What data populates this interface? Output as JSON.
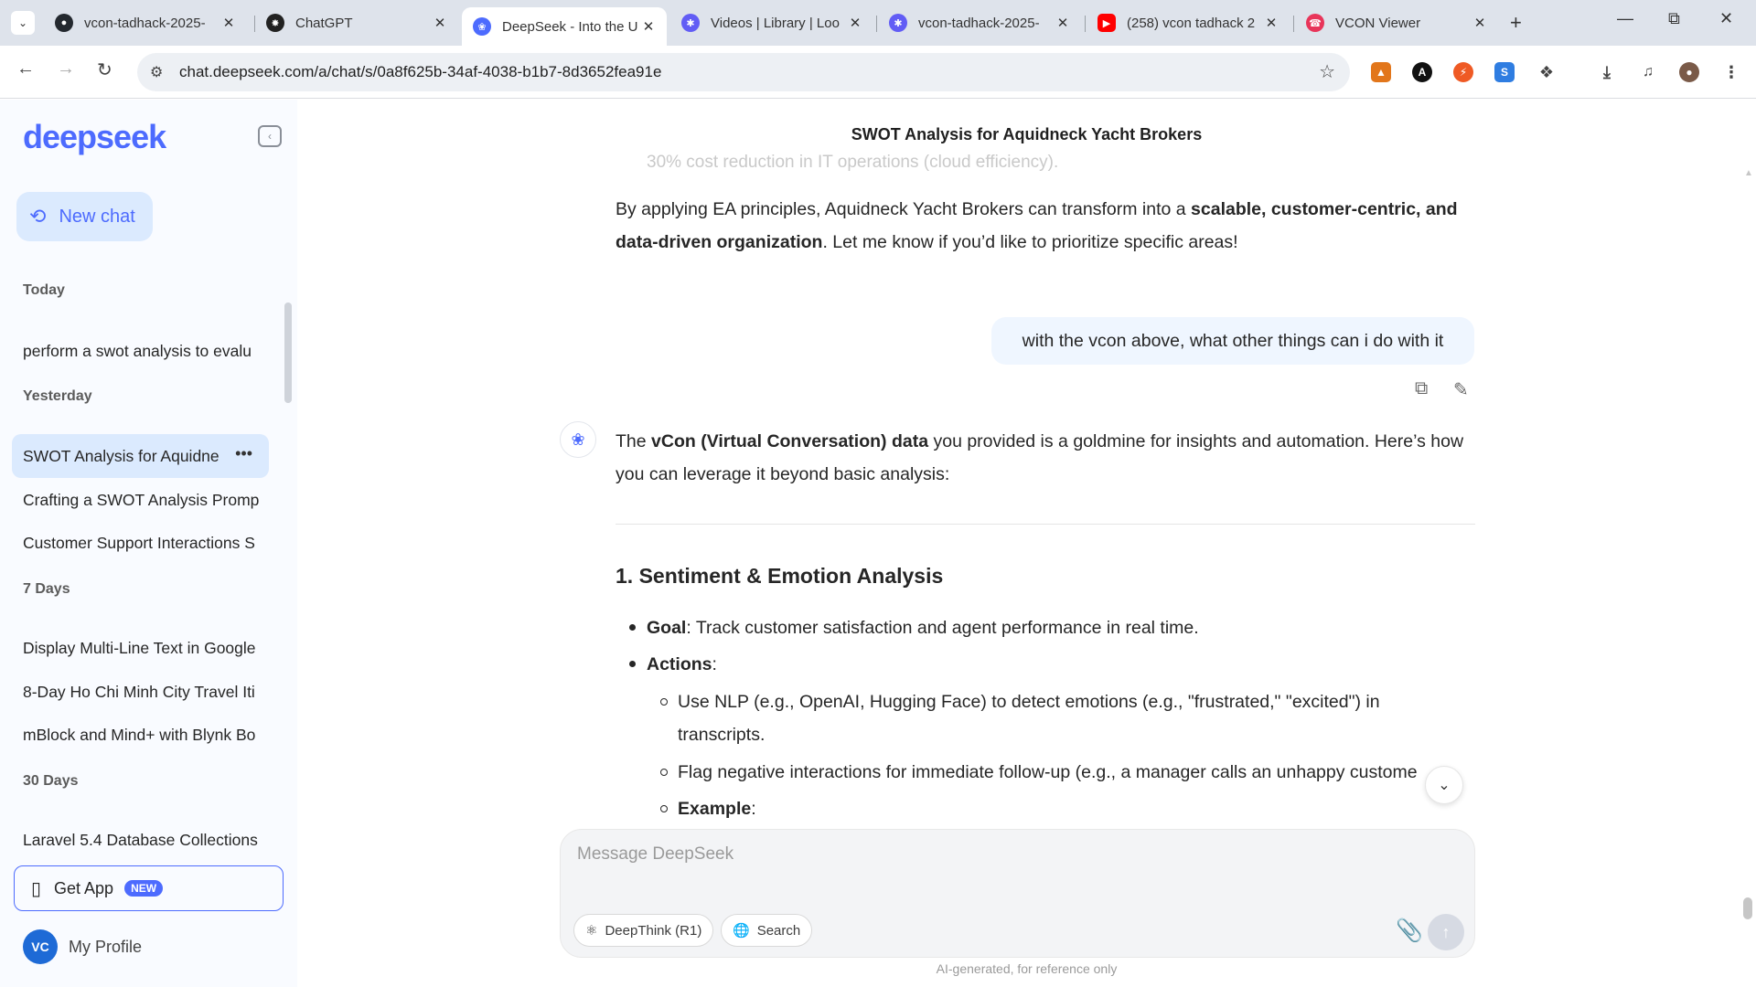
{
  "browser": {
    "tabs": [
      {
        "title": "vcon-tadhack-2025-",
        "favicon": "github-icon",
        "color": "#24292f",
        "active": false
      },
      {
        "title": "ChatGPT",
        "favicon": "openai-icon",
        "color": "#222222",
        "active": false
      },
      {
        "title": "DeepSeek - Into the U",
        "favicon": "deepseek-icon",
        "color": "#4d6bfe",
        "active": true
      },
      {
        "title": "Videos | Library | Loo",
        "favicon": "loom-icon",
        "color": "#625df5",
        "active": false
      },
      {
        "title": "vcon-tadhack-2025-",
        "favicon": "loom-icon",
        "color": "#625df5",
        "active": false
      },
      {
        "title": "(258) vcon tadhack 2",
        "favicon": "youtube-icon",
        "color": "#ff0000",
        "active": false
      },
      {
        "title": "VCON Viewer",
        "favicon": "phone-icon",
        "color": "#e8355a",
        "active": false
      }
    ],
    "url": "chat.deepseek.com/a/chat/s/0a8f625b-34af-4038-b1b7-8d3652fea91e"
  },
  "sidebar": {
    "logo": "deepseek",
    "new_chat_label": "New chat",
    "sections": [
      {
        "label": "Today",
        "items": [
          "perform a swot analysis to evalu"
        ]
      },
      {
        "label": "Yesterday",
        "items": [
          "SWOT Analysis for Aquidne",
          "Crafting a SWOT Analysis Promp",
          "Customer Support Interactions S"
        ]
      },
      {
        "label": "7 Days",
        "items": [
          "Display Multi-Line Text in Google",
          "8-Day Ho Chi Minh City Travel Iti",
          "mBlock and Mind+ with Blynk Bo"
        ]
      },
      {
        "label": "30 Days",
        "items": [
          "Laravel 5.4 Database Collections"
        ]
      }
    ],
    "get_app_label": "Get App",
    "get_app_badge": "NEW",
    "profile_initials": "VC",
    "profile_label": "My Profile"
  },
  "chat": {
    "title": "SWOT Analysis for Aquidneck Yacht Brokers",
    "faded_line": "30% cost reduction in IT operations (cloud efficiency).",
    "prev_answer_a": "By applying EA principles, Aquidneck Yacht Brokers can transform into a ",
    "prev_answer_bold": "scalable, customer-centric, and data-driven organization",
    "prev_answer_b": ". Let me know if you’d like to prioritize specific areas!",
    "user_message": "with the vcon above, what other things can i do with it",
    "reply_a": "The ",
    "reply_bold": "vCon (Virtual Conversation) data",
    "reply_b": " you provided is a goldmine for insights and automation. Here’s how you can leverage it beyond basic analysis:",
    "heading": "1. Sentiment & Emotion Analysis",
    "goal_label": "Goal",
    "goal_text": ": Track customer satisfaction and agent performance in real time.",
    "actions_label": "Actions",
    "actions_colon": ":",
    "sub1": "Use NLP (e.g., OpenAI, Hugging Face) to detect emotions (e.g., \"frustrated,\" \"excited\") in transcripts.",
    "sub2": "Flag negative interactions for immediate follow-up (e.g., a manager calls an unhappy custome",
    "sub3_label": "Example",
    "sub3_colon": ":"
  },
  "composer": {
    "placeholder": "Message DeepSeek",
    "deepthink_label": "DeepThink (R1)",
    "search_label": "Search",
    "disclaimer": "AI-generated, for reference only"
  }
}
